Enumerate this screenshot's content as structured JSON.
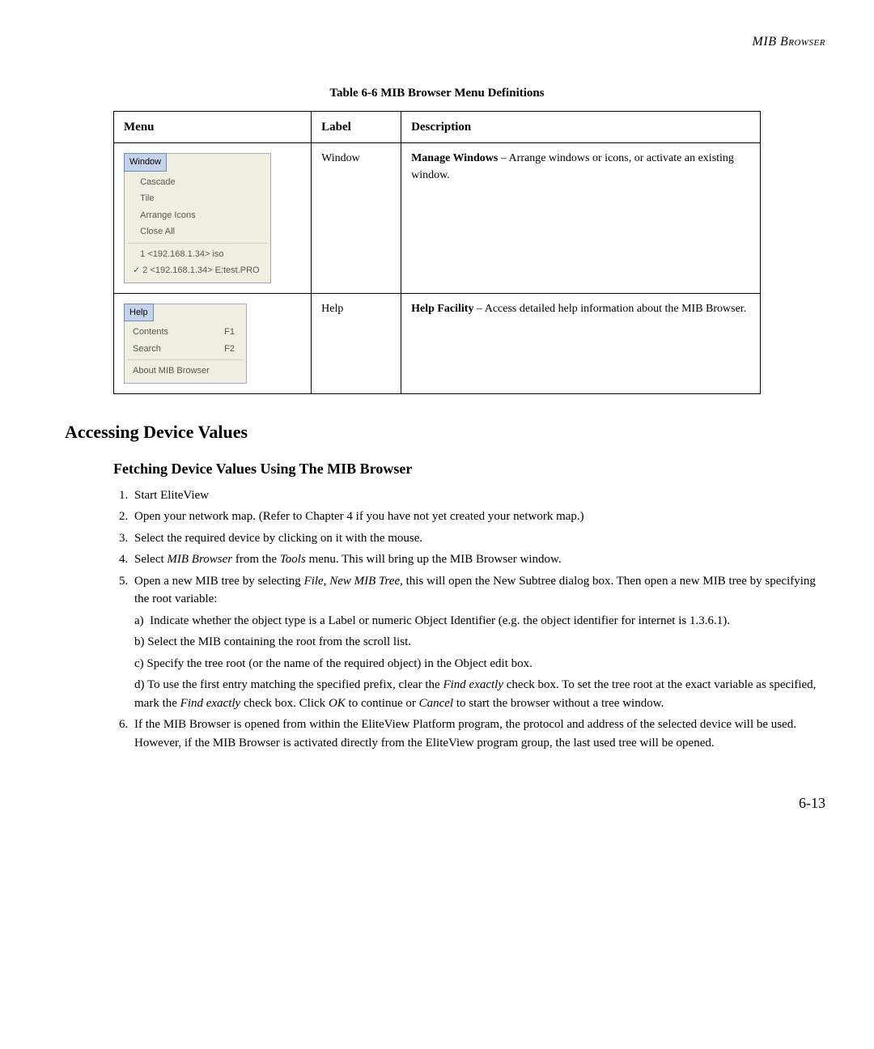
{
  "header": "MIB Browser",
  "table": {
    "caption": "Table 6-6  MIB Browser Menu Definitions",
    "headers": {
      "menu": "Menu",
      "label": "Label",
      "description": "Description"
    },
    "rows": [
      {
        "menu_title": "Window",
        "menu_items": [
          "Cascade",
          "Tile",
          "Arrange Icons",
          "Close All"
        ],
        "menu_items2": [
          "1 <192.168.1.34> iso",
          "2 <192.168.1.34> E:test.PRO"
        ],
        "label": "Window",
        "desc_bold": "Manage Windows",
        "desc_rest": " – Arrange windows or icons, or activate an existing window."
      },
      {
        "menu_title": "Help",
        "help_items": [
          {
            "label": "Contents",
            "key": "F1"
          },
          {
            "label": "Search",
            "key": "F2"
          }
        ],
        "help_about": "About MIB Browser",
        "label": "Help",
        "desc_bold": "Help Facility",
        "desc_rest": " – Access detailed help information about the MIB Browser."
      }
    ]
  },
  "section_title": "Accessing Device Values",
  "subsection_title": "Fetching Device Values Using The MIB Browser",
  "steps": {
    "s1": "Start EliteView",
    "s2": "Open your network map. (Refer to Chapter 4 if you have not yet created your network map.)",
    "s3": "Select the required device by clicking on it with the mouse.",
    "s4_pre": "Select ",
    "s4_i1": "MIB Browser",
    "s4_mid": " from the ",
    "s4_i2": "Tools",
    "s4_post": " menu. This will bring up the MIB Browser window.",
    "s5_pre": "Open a new MIB tree by selecting ",
    "s5_i1": "File",
    "s5_mid1": ", ",
    "s5_i2": "New MIB Tree",
    "s5_post": ", this will open the New Subtree dialog box. Then open a new MIB tree by specifying the root variable:",
    "s5a": "Indicate whether the object type is a Label or numeric Object Identifier (e.g. the object identifier for internet is 1.3.6.1).",
    "s5b": "b) Select the MIB containing the root from the scroll list.",
    "s5c": "c) Specify the tree root (or the name of the required object) in the Object edit box.",
    "s5d_pre": "d) To use the first entry matching the specified prefix, clear the ",
    "s5d_i1": "Find exactly",
    "s5d_mid1": " check box. To set the tree root at the exact variable as specified, mark the ",
    "s5d_i2": "Find exactly",
    "s5d_mid2": " check box. Click ",
    "s5d_i3": "OK",
    "s5d_mid3": " to continue or ",
    "s5d_i4": "Cancel",
    "s5d_post": " to start the browser without a tree window.",
    "s6": "If the MIB Browser is opened from within the EliteView Platform program, the protocol and address of the selected device will be used. However, if the MIB Browser is activated directly from the EliteView program group, the last used tree will be opened."
  },
  "page_number": "6-13"
}
